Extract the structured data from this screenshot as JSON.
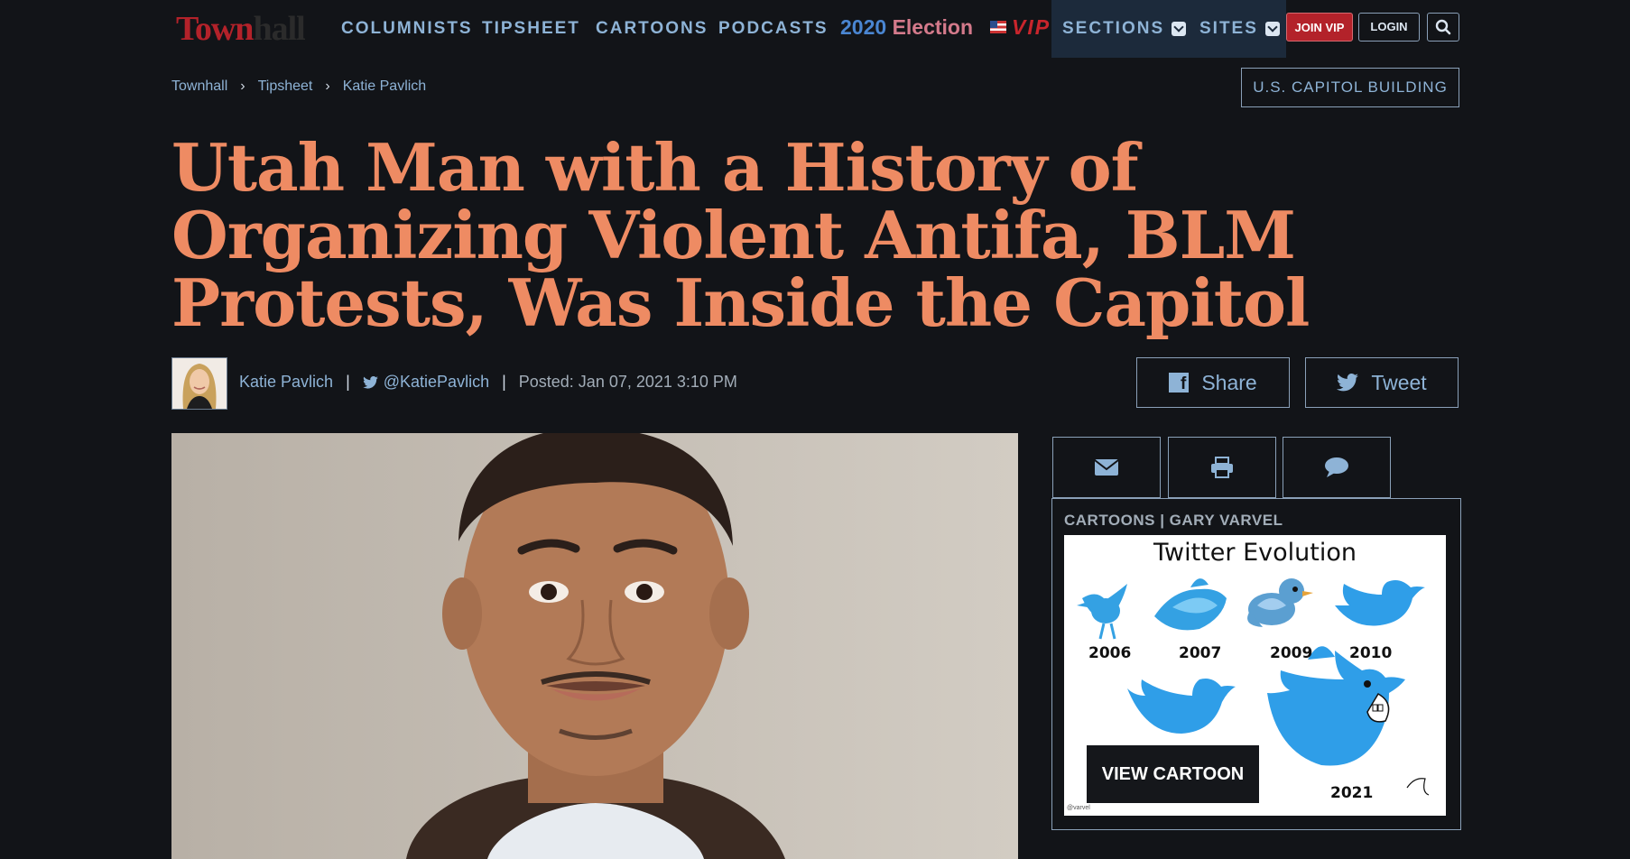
{
  "nav": {
    "logo_town": "Town",
    "logo_hall": "hall",
    "columnists": "COLUMNISTS",
    "tipsheet": "TIPSHEET",
    "cartoons": "CARTOONS",
    "podcasts": "PODCASTS",
    "election_year": "2020",
    "election_word": "Election",
    "vip": "VIP",
    "sections": "SECTIONS",
    "sites": "SITES",
    "join_vip": "JOIN VIP",
    "login": "LOGIN"
  },
  "breadcrumb": [
    "Townhall",
    "Tipsheet",
    "Katie Pavlich"
  ],
  "topic_tag": "U.S. CAPITOL BUILDING",
  "headline": "Utah Man with a History of Organizing Violent Antifa, BLM Protests, Was Inside the Capitol",
  "byline": {
    "author": "Katie Pavlich",
    "twitter": "@KatiePavlich",
    "posted": "Posted: Jan 07, 2021 3:10 PM"
  },
  "share": {
    "facebook": "Share",
    "twitter": "Tweet"
  },
  "utility_icons": [
    "envelope-icon",
    "print-icon",
    "comment-icon"
  ],
  "cartoon": {
    "label": "CARTOONS | GARY VARVEL",
    "title": "Twitter Evolution",
    "years": [
      "2006",
      "2007",
      "2009",
      "2010",
      "2021"
    ],
    "button": "VIEW CARTOON",
    "credit": "@varvel"
  },
  "colors": {
    "background": "#121418",
    "headline": "#ee8b63",
    "link": "#8eb3d6",
    "brand_red": "#b3222a",
    "twitter_blue": "#34a1e3"
  }
}
